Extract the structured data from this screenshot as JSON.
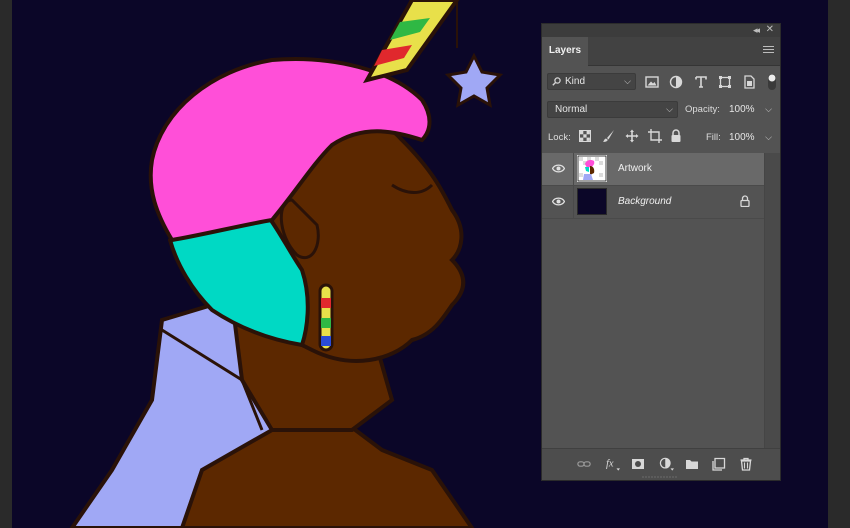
{
  "panel": {
    "tab_label": "Layers",
    "filter": {
      "selected": "Kind",
      "icons": [
        "image-filter-icon",
        "adjustment-filter-icon",
        "type-filter-icon",
        "shape-filter-icon",
        "smart-object-filter-icon",
        "filter-toggle"
      ]
    },
    "blend_mode": "Normal",
    "opacity_label": "Opacity:",
    "opacity_value": "100%",
    "lock_label": "Lock:",
    "lock_icons": [
      "lock-transparency-icon",
      "lock-image-pixels-icon",
      "lock-position-icon",
      "lock-artboard-icon",
      "lock-all-icon"
    ],
    "fill_label": "Fill:",
    "fill_value": "100%",
    "layers": [
      {
        "name": "Artwork",
        "visible": true,
        "selected": true,
        "italic": false,
        "locked": false
      },
      {
        "name": "Background",
        "visible": true,
        "selected": false,
        "italic": true,
        "locked": true
      }
    ],
    "footer_icons": [
      "link-layers-icon",
      "fx-icon",
      "add-mask-icon",
      "adjustment-layer-icon",
      "new-group-icon",
      "new-layer-icon",
      "trash-icon"
    ]
  },
  "colors": {
    "canvas_bg": "#0b0628",
    "hair_pink": "#ff4fd8",
    "hair_teal": "#00d9c4",
    "skin": "#5c2800",
    "dress": "#a0a8f5",
    "panel_bg": "#535353",
    "selected_row": "#696969"
  }
}
